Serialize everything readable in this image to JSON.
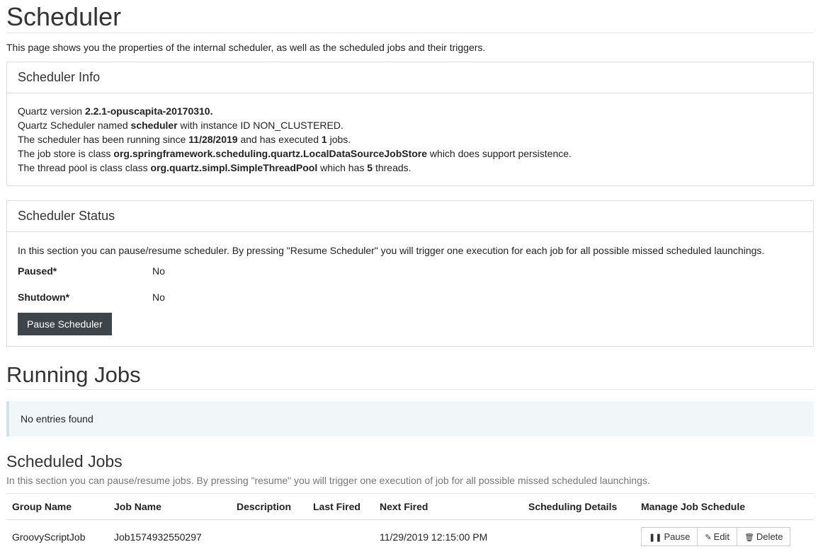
{
  "page": {
    "title": "Scheduler",
    "intro": "This page shows you the properties of the internal scheduler, as well as the scheduled jobs and their triggers."
  },
  "info": {
    "heading": "Scheduler Info",
    "l1_a": "Quartz version ",
    "l1_b": "2.2.1-opuscapita-20170310.",
    "l2_a": "Quartz Scheduler named ",
    "l2_b": "scheduler",
    "l2_c": " with instance ID NON_CLUSTERED.",
    "l3_a": "The scheduler has been running since ",
    "l3_b": "11/28/2019",
    "l3_c": " and has executed ",
    "l3_d": "1",
    "l3_e": " jobs.",
    "l4_a": "The job store is class ",
    "l4_b": "org.springframework.scheduling.quartz.LocalDataSourceJobStore",
    "l4_c": " which does support persistence.",
    "l5_a": "The thread pool is class class ",
    "l5_b": "org.quartz.simpl.SimpleThreadPool",
    "l5_c": " which has ",
    "l5_d": "5",
    "l5_e": " threads."
  },
  "status": {
    "heading": "Scheduler Status",
    "description": "In this section you can pause/resume scheduler. By pressing \"Resume Scheduler\" you will trigger one execution for each job for all possible missed scheduled launchings.",
    "paused_label": "Paused*",
    "paused_value": "No",
    "shutdown_label": "Shutdown*",
    "shutdown_value": "No",
    "pause_button": "Pause Scheduler"
  },
  "running": {
    "title": "Running Jobs",
    "empty": "No entries found"
  },
  "scheduled": {
    "title": "Scheduled Jobs",
    "description": "In this section you can pause/resume jobs. By pressing \"resume\" you will trigger one execution of job for all possible missed scheduled launchings.",
    "columns": [
      "Group Name",
      "Job Name",
      "Description",
      "Last Fired",
      "Next Fired",
      "Scheduling Details",
      "Manage Job Schedule"
    ],
    "rows": [
      {
        "group": "GroovyScriptJob",
        "job": "Job1574932550297",
        "description": "",
        "last_fired": "",
        "next_fired": "11/29/2019 12:15:00 PM",
        "details": "",
        "pause_label": "Pause",
        "edit_label": "Edit",
        "delete_label": "Delete"
      }
    ],
    "icons": {
      "pause": "pause-icon",
      "edit": "pencil-icon",
      "delete": "trash-icon"
    }
  }
}
